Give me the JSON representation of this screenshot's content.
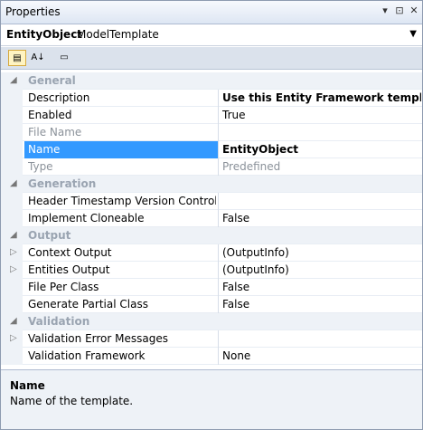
{
  "window": {
    "title": "Properties",
    "pin_glyph": "▾",
    "autohide_glyph": "⊡",
    "close_glyph": "✕"
  },
  "object": {
    "name": "EntityObject",
    "type": "ModelTemplate",
    "dropdown_glyph": "▼"
  },
  "toolbar": {
    "categorized_glyph": "▤",
    "alphabetical_glyph": "A↓",
    "pages_glyph": "▭"
  },
  "grid": {
    "rows": [
      {
        "kind": "category",
        "label": "General",
        "expander": "◢"
      },
      {
        "kind": "property",
        "name": "Description",
        "value": "Use this Entity Framework template to",
        "value_bold": true
      },
      {
        "kind": "property",
        "name": "Enabled",
        "value": "True"
      },
      {
        "kind": "property",
        "name": "File Name",
        "value": "",
        "disabled": true
      },
      {
        "kind": "property",
        "name": "Name",
        "value": "EntityObject",
        "value_bold": true,
        "selected": true
      },
      {
        "kind": "property",
        "name": "Type",
        "value": "Predefined",
        "disabled": true
      },
      {
        "kind": "category",
        "label": "Generation",
        "expander": "◢"
      },
      {
        "kind": "property",
        "name": "Header Timestamp Version Control Tag",
        "value": ""
      },
      {
        "kind": "property",
        "name": "Implement Cloneable",
        "value": "False"
      },
      {
        "kind": "category",
        "label": "Output",
        "expander": "◢"
      },
      {
        "kind": "property",
        "name": "Context Output",
        "value": "(OutputInfo)",
        "expandable": true,
        "expander": "▷"
      },
      {
        "kind": "property",
        "name": "Entities Output",
        "value": "(OutputInfo)",
        "expandable": true,
        "expander": "▷"
      },
      {
        "kind": "property",
        "name": "File Per Class",
        "value": "False"
      },
      {
        "kind": "property",
        "name": "Generate Partial Class",
        "value": "False"
      },
      {
        "kind": "category",
        "label": "Validation",
        "expander": "◢"
      },
      {
        "kind": "property",
        "name": "Validation Error Messages",
        "value": "",
        "expandable": true,
        "expander": "▷"
      },
      {
        "kind": "property",
        "name": "Validation Framework",
        "value": "None"
      }
    ]
  },
  "description": {
    "title": "Name",
    "text": "Name of the template."
  }
}
